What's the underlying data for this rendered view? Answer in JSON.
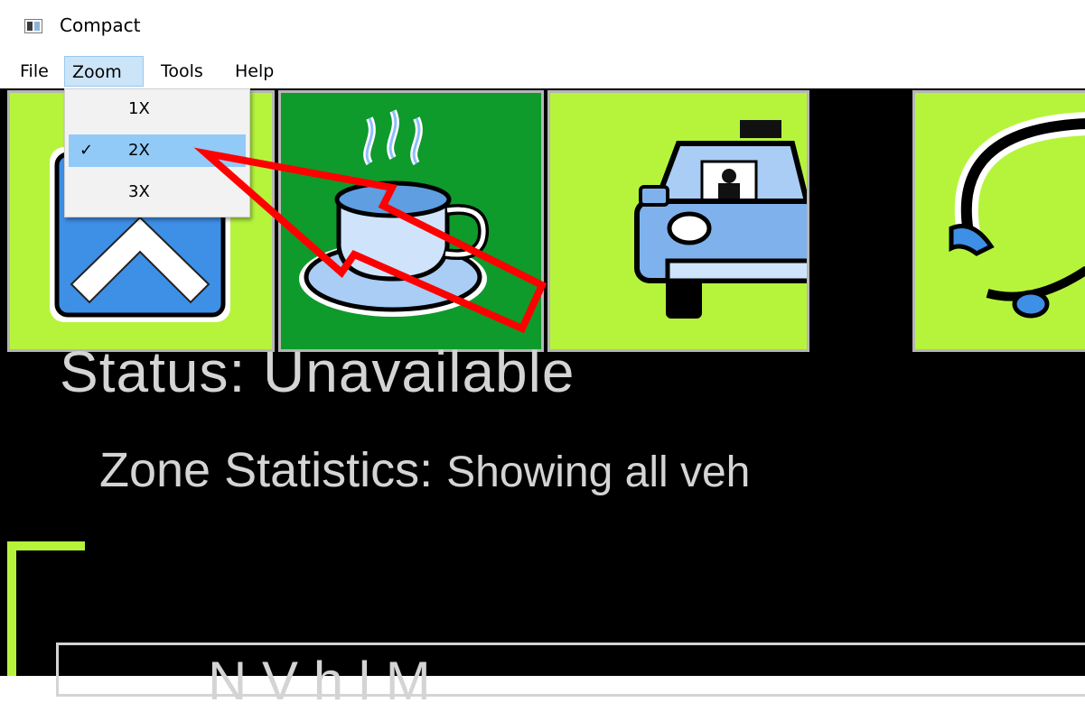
{
  "window": {
    "title": "Compact"
  },
  "menu": {
    "file": "File",
    "zoom": "Zoom",
    "tools": "Tools",
    "help": "Help"
  },
  "zoom_menu": {
    "items": [
      {
        "label": "1X",
        "checked": false
      },
      {
        "label": "2X",
        "checked": true
      },
      {
        "label": "3X",
        "checked": false
      }
    ],
    "check_glyph": "✓"
  },
  "toolbar": {
    "buttons": [
      {
        "icon": "up-arrow-icon",
        "bg": "#b6f43c"
      },
      {
        "icon": "coffee-cup-icon",
        "bg": "#0f9a2c"
      },
      {
        "icon": "taxi-icon",
        "bg": "#b6f43c"
      },
      {
        "icon": "headset-icon",
        "bg": "#b6f43c"
      }
    ]
  },
  "status": {
    "text": "Status: Unavailable"
  },
  "zone": {
    "label": "Zone Statistics:",
    "detail": "Showing all veh"
  },
  "table": {
    "header_fragment": "N          V   h   l     M"
  },
  "annotation": {
    "arrow_color": "#ff0000"
  }
}
